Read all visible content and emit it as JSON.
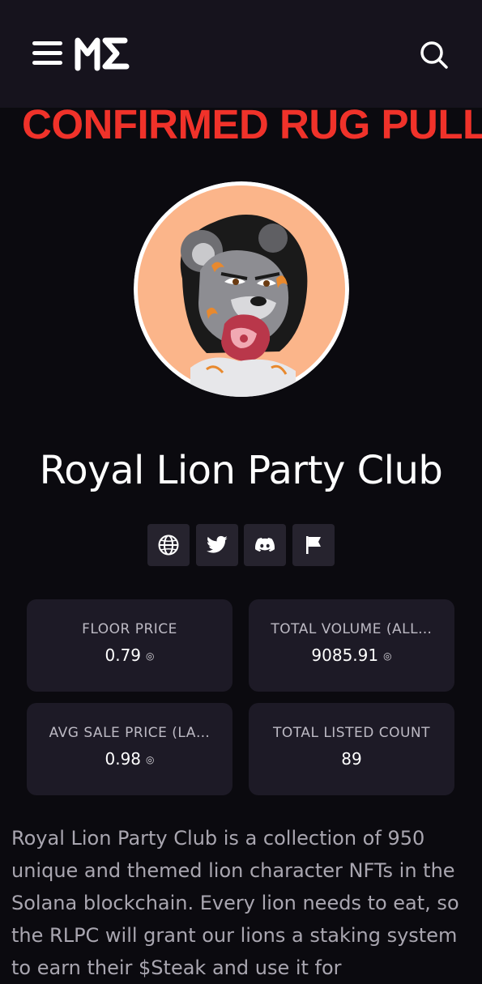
{
  "header": {
    "menu_icon": "hamburger-menu-icon",
    "logo_icon": "magic-eden-logo",
    "search_icon": "search-icon"
  },
  "banner": {
    "text": "CONFIRMED RUG PULL",
    "color": "#f0322a"
  },
  "collection": {
    "title": "Royal Lion Party Club",
    "avatar_background": "#fbb58a"
  },
  "socials": [
    {
      "icon": "globe-icon"
    },
    {
      "icon": "twitter-icon"
    },
    {
      "icon": "discord-icon"
    },
    {
      "icon": "flag-icon"
    }
  ],
  "stats": {
    "floor_price": {
      "label": "FLOOR PRICE",
      "value": "0.79",
      "unit": "◎"
    },
    "total_volume": {
      "label": "TOTAL VOLUME (ALL…",
      "value": "9085.91",
      "unit": "◎"
    },
    "avg_sale_price": {
      "label": "AVG SALE PRICE (LA…",
      "value": "0.98",
      "unit": "◎"
    },
    "total_listed": {
      "label": "TOTAL LISTED COUNT",
      "value": "89"
    }
  },
  "description": "Royal Lion Party Club is a collection of 950 unique and themed lion character NFTs in the Solana blockchain. Every lion needs to eat, so the RLPC will grant our lions a staking system to earn their $Steak and use it for"
}
